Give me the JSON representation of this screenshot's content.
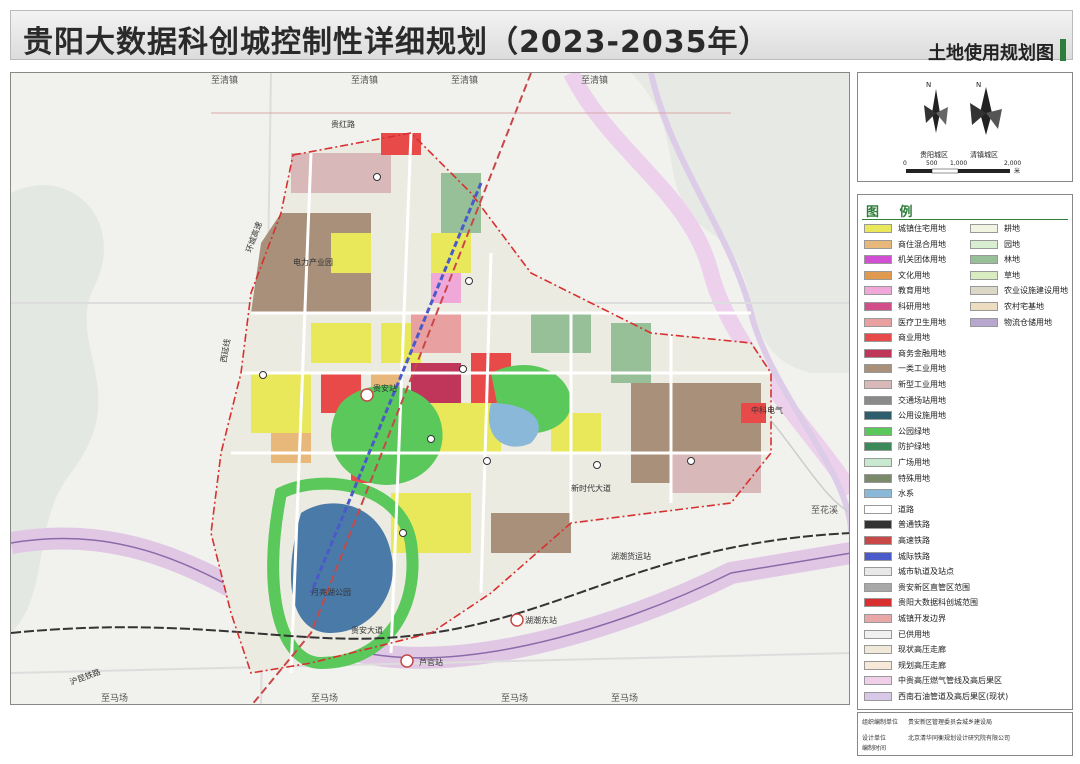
{
  "title": "贵阳大数据科创城控制性详细规划（2023-2035年）",
  "subtitle": "土地使用规划图",
  "compass": {
    "north": "N",
    "left_label": "贵阳城区",
    "right_label": "清镇城区",
    "scale_ticks": [
      "0",
      "500",
      "1,000",
      "2,000"
    ],
    "scale_unit": "米"
  },
  "legend": {
    "title": "图 例",
    "left_items": [
      {
        "label": "城镇住宅用地",
        "color": "#e8e85a"
      },
      {
        "label": "商住混合用地",
        "color": "#e8b87a"
      },
      {
        "label": "机关团体用地",
        "color": "#d24fd4"
      },
      {
        "label": "文化用地",
        "color": "#e09a50"
      },
      {
        "label": "教育用地",
        "color": "#f0a8d8"
      },
      {
        "label": "科研用地",
        "color": "#d24e8a"
      },
      {
        "label": "医疗卫生用地",
        "color": "#e8a0a0"
      },
      {
        "label": "商业用地",
        "color": "#e84a4a"
      },
      {
        "label": "商务金融用地",
        "color": "#c0365a"
      },
      {
        "label": "一类工业用地",
        "color": "#a8907a"
      },
      {
        "label": "新型工业用地",
        "color": "#d8b8b8"
      },
      {
        "label": "交通场站用地",
        "color": "#8a8a8a"
      },
      {
        "label": "公用设施用地",
        "color": "#2e5d6e"
      },
      {
        "label": "公园绿地",
        "color": "#5ac85a"
      },
      {
        "label": "防护绿地",
        "color": "#3a8a5a"
      },
      {
        "label": "广场用地",
        "color": "#c8e8d0"
      },
      {
        "label": "特殊用地",
        "color": "#7a8a6a"
      },
      {
        "label": "水系",
        "color": "#8ab8d8"
      },
      {
        "label": "道路",
        "color": "#ffffff"
      },
      {
        "label": "普通铁路",
        "color": "#333333"
      },
      {
        "label": "高速铁路",
        "color": "#c84848"
      },
      {
        "label": "城际铁路",
        "color": "#4a5ac8"
      },
      {
        "label": "城市轨道及站点",
        "color": "#e8e8e8"
      },
      {
        "label": "贵安新区直管区范围",
        "color": "#a8a8a8"
      },
      {
        "label": "贵阳大数据科创城范围",
        "color": "#d83030"
      },
      {
        "label": "城镇开发边界",
        "color": "#e8a8a8"
      },
      {
        "label": "已供用地",
        "color": "#f0f0f0"
      },
      {
        "label": "现状高压走廊",
        "color": "#f0e8d8"
      },
      {
        "label": "规划高压走廊",
        "color": "#f8e8d8"
      },
      {
        "label": "中贵高压燃气管线及高后果区",
        "color": "#f0d0e8"
      },
      {
        "label": "西南石油管道及高后果区(现状)",
        "color": "#d8c8e8"
      }
    ],
    "right_items": [
      {
        "label": "耕地",
        "color": "#f0f4e0"
      },
      {
        "label": "园地",
        "color": "#d8eed0"
      },
      {
        "label": "林地",
        "color": "#98c098"
      },
      {
        "label": "草地",
        "color": "#d8ecc0"
      },
      {
        "label": "农业设施建设用地",
        "color": "#dcd8c8"
      },
      {
        "label": "农村宅基地",
        "color": "#ecdcc0"
      },
      {
        "label": "物流仓储用地",
        "color": "#b8a8d0"
      }
    ]
  },
  "footer": {
    "org_label": "组织编制单位",
    "org_value": "贵安新区管理委员会城乡建设局",
    "design_label": "设计单位",
    "design_value": "北京清华同衡规划设计研究院有限公司",
    "time_label": "编制时间",
    "time_value": ""
  },
  "map_labels": {
    "towns_top": [
      "至清镇",
      "至清镇",
      "至清镇",
      "至清镇"
    ],
    "road_north": "贵红路",
    "ring_road": "环城高速",
    "west_label": "西延线",
    "park_label": "月亮湖公园",
    "hub_label": "贵安站",
    "pillar_label": "电力产业园",
    "east_label": "中科电气",
    "station_1": "湖潮货运站",
    "station_2": "湖潮东站",
    "station_3": "芦官站",
    "rail_label": "沪昆铁路",
    "highway_label": "贵安大道",
    "bottom_towns": [
      "至马场",
      "至马场",
      "至马场",
      "至马场"
    ],
    "east_exit": "至花溪",
    "avenue_label": "新时代大道"
  },
  "map_colors": {
    "background": "#f4f4f1",
    "boundary": "#d83030",
    "highspeed_rail": "#c84848",
    "intercity_rail": "#4a5ac8",
    "gas_line": "#e0b8e0",
    "oil_line": "#c8a8d8"
  }
}
